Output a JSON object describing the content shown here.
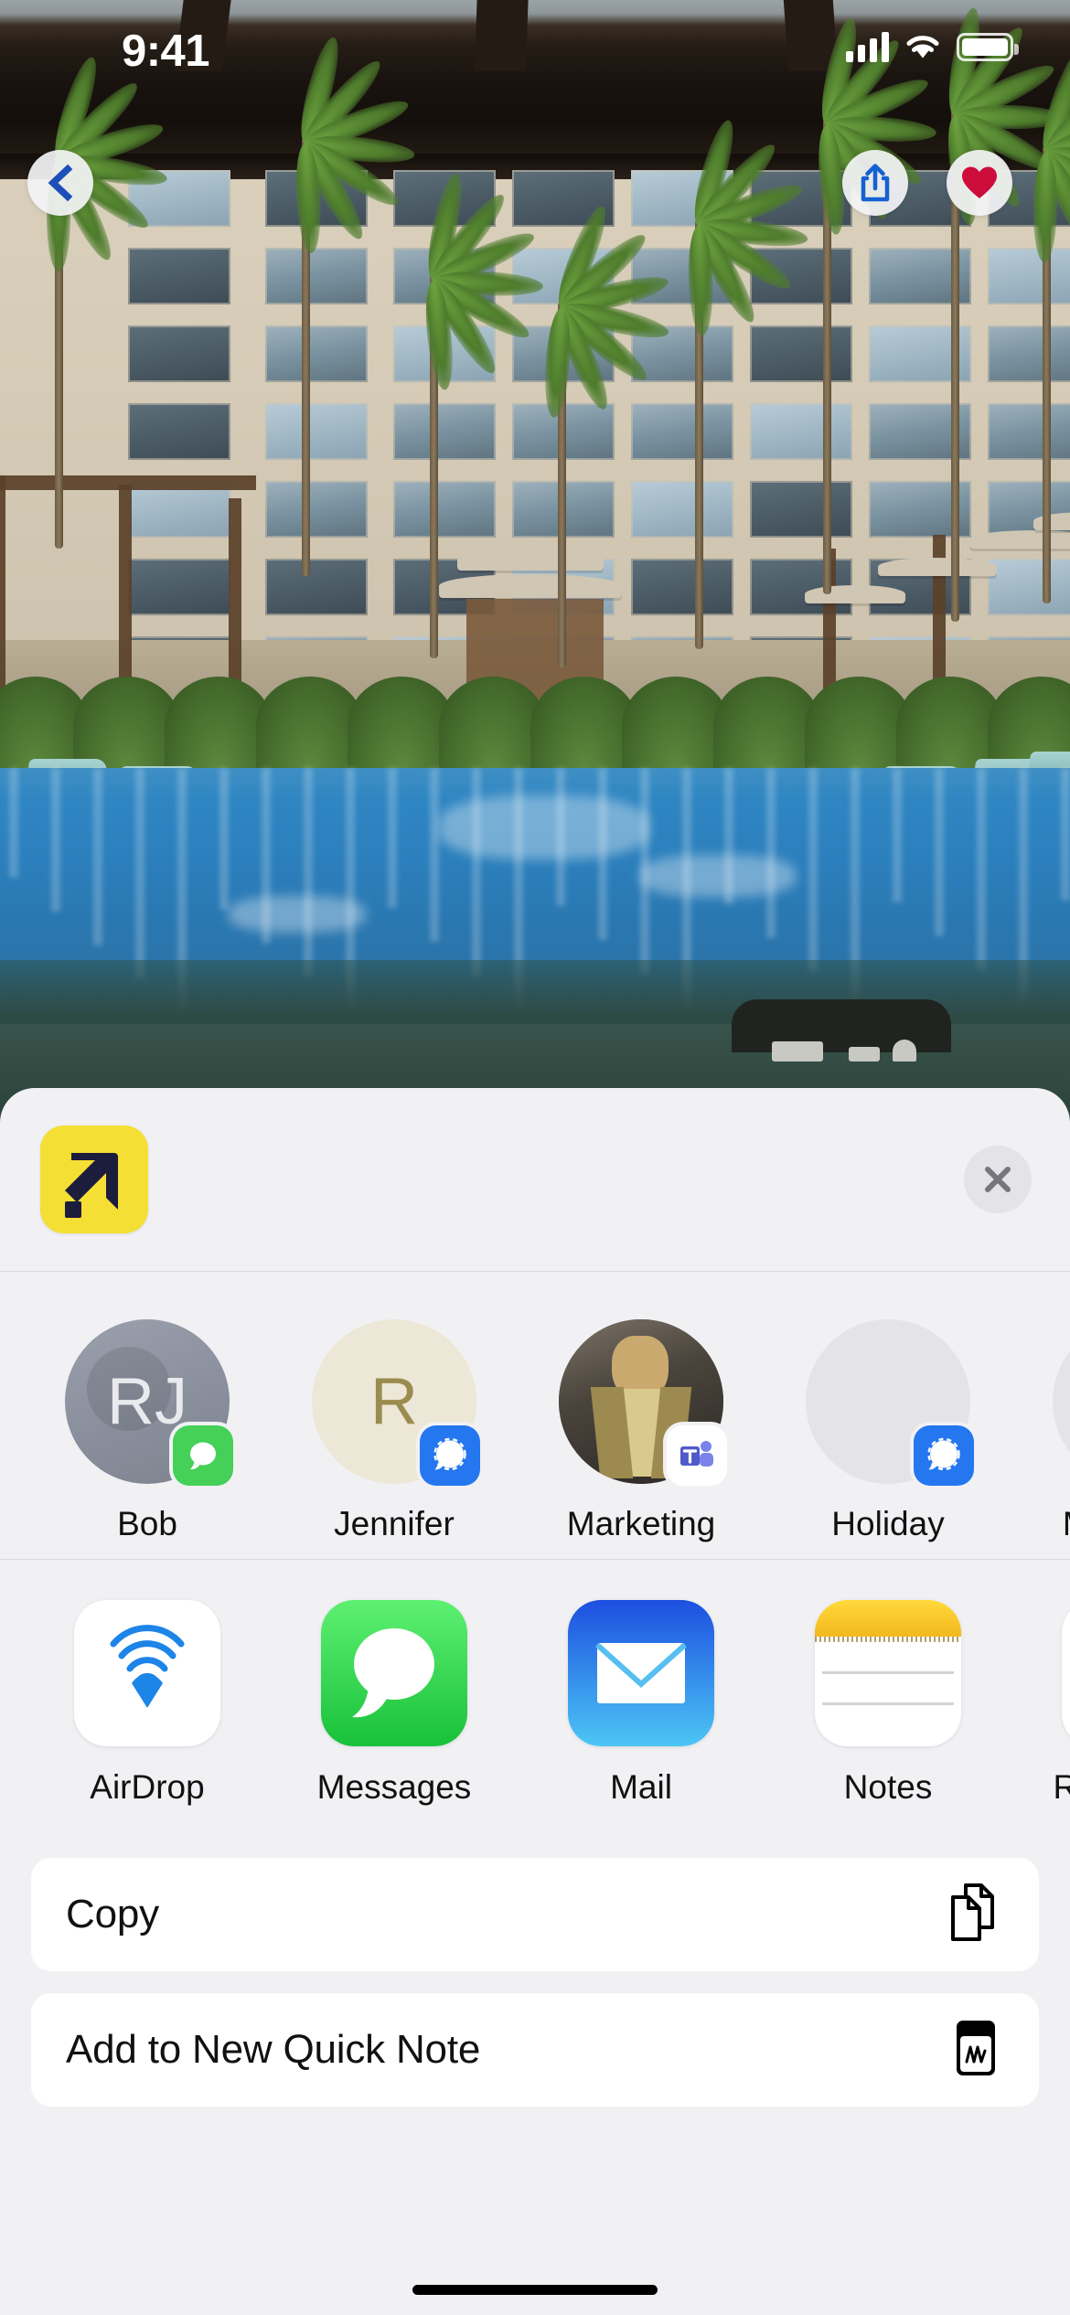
{
  "status_bar": {
    "time": "9:41",
    "signal_icon": "cellular-signal-icon",
    "wifi_icon": "wifi-icon",
    "battery_icon": "battery-icon"
  },
  "photo_view": {
    "back_icon": "chevron-left-icon",
    "share_icon": "share-up-arrow-icon",
    "favorite_icon": "heart-icon",
    "favorite_color": "#cc0d3c",
    "share_color": "#1461d2",
    "image_description": "resort swimming pool with hotel building and palm trees"
  },
  "share_sheet": {
    "app_icon_name": "source-app-icon",
    "app_icon_background": "#f5df34",
    "app_icon_glyph_color": "#1c1c3c",
    "close_label": "✕",
    "close_icon": "close-icon",
    "contacts": [
      {
        "name": "Bob",
        "avatar_type": "initials",
        "initials": "RJ",
        "avatar_color": "#8a8f9d",
        "badge_app": "messages",
        "badge_icon": "messages-badge-icon"
      },
      {
        "name": "Jennifer",
        "avatar_type": "initials",
        "initials": "R",
        "avatar_color": "#ece7d6",
        "badge_app": "signal",
        "badge_icon": "signal-badge-icon"
      },
      {
        "name": "Marketing",
        "avatar_type": "photo",
        "initials": "",
        "avatar_color": "#3a3530",
        "badge_app": "teams",
        "badge_icon": "teams-badge-icon"
      },
      {
        "name": "Holiday",
        "avatar_type": "blank",
        "initials": "",
        "avatar_color": "#e4e4e8",
        "badge_app": "signal",
        "badge_icon": "signal-badge-icon"
      },
      {
        "name": "Mee Sam",
        "avatar_type": "blank",
        "initials": "",
        "avatar_color": "#eceaef",
        "badge_app": "none",
        "badge_icon": "none"
      }
    ],
    "apps": [
      {
        "label": "AirDrop",
        "icon": "airdrop-icon"
      },
      {
        "label": "Messages",
        "icon": "messages-icon"
      },
      {
        "label": "Mail",
        "icon": "mail-icon"
      },
      {
        "label": "Notes",
        "icon": "notes-icon"
      },
      {
        "label": "Reminders",
        "icon": "reminders-icon"
      }
    ],
    "actions": [
      {
        "label": "Copy",
        "icon": "copy-icon"
      },
      {
        "label": "Add to New Quick Note",
        "icon": "quick-note-icon"
      }
    ]
  }
}
